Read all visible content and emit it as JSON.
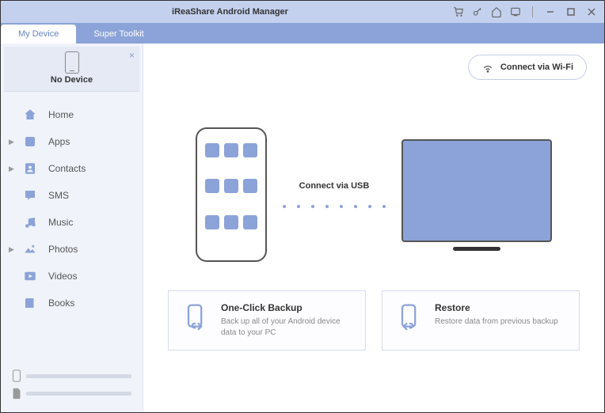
{
  "titlebar": {
    "title": "iReaShare Android Manager"
  },
  "tabs": {
    "my_device": "My Device",
    "super_toolkit": "Super Toolkit"
  },
  "device": {
    "label": "No Device"
  },
  "nav": {
    "home": "Home",
    "apps": "Apps",
    "contacts": "Contacts",
    "sms": "SMS",
    "music": "Music",
    "photos": "Photos",
    "videos": "Videos",
    "books": "Books"
  },
  "wifi_button": "Connect via Wi-Fi",
  "connect_label": "Connect via USB",
  "actions": {
    "backup": {
      "title": "One-Click Backup",
      "desc": "Back up all of your Android device data to your PC"
    },
    "restore": {
      "title": "Restore",
      "desc": "Restore data from previous backup"
    }
  }
}
